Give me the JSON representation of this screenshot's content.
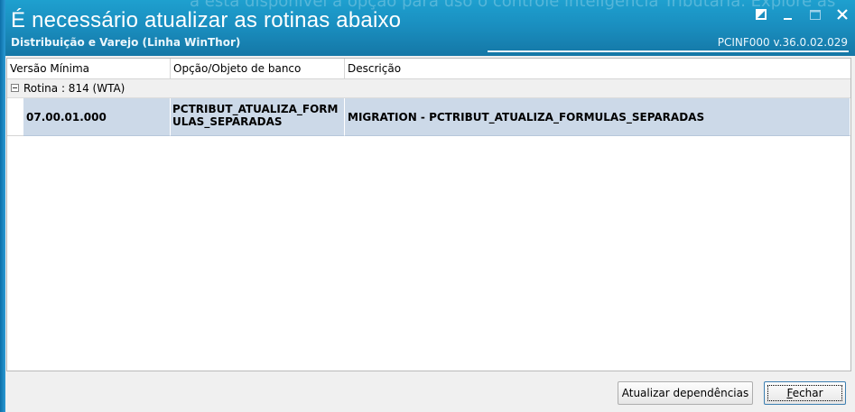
{
  "window": {
    "title": "É necessário atualizar as rotinas abaixo",
    "subtitle": "Distribuição e Varejo (Linha WinThor)",
    "version": "PCINF000  v.36.0.02.029",
    "background_text": "á esta disponível a opção para uso o controle inteligência Tributária. Explore as",
    "controls": {
      "restore_icon": "restore-icon",
      "minimize_icon": "minimize-icon",
      "maximize_icon": "maximize-icon",
      "close_icon": "close-icon"
    }
  },
  "grid": {
    "columns": [
      "Versão Mínima",
      "Opção/Objeto de banco",
      "Descrição"
    ],
    "group": {
      "label": "Rotina : 814 (WTA)",
      "expanded": true
    },
    "rows": [
      {
        "version": "07.00.01.000",
        "object": "PCTRIBUT_ATUALIZA_FORMULAS_SEPARADAS",
        "description": "MIGRATION - PCTRIBUT_ATUALIZA_FORMULAS_SEPARADAS",
        "selected": true
      }
    ]
  },
  "footer": {
    "update_button": "Atualizar dependências",
    "close_button_mnemonic": "F",
    "close_button_rest": "echar"
  },
  "colors": {
    "titlebar": "#1a8fc0",
    "selected_row": "#ccd9e8",
    "group_row": "#f0f0f0"
  }
}
